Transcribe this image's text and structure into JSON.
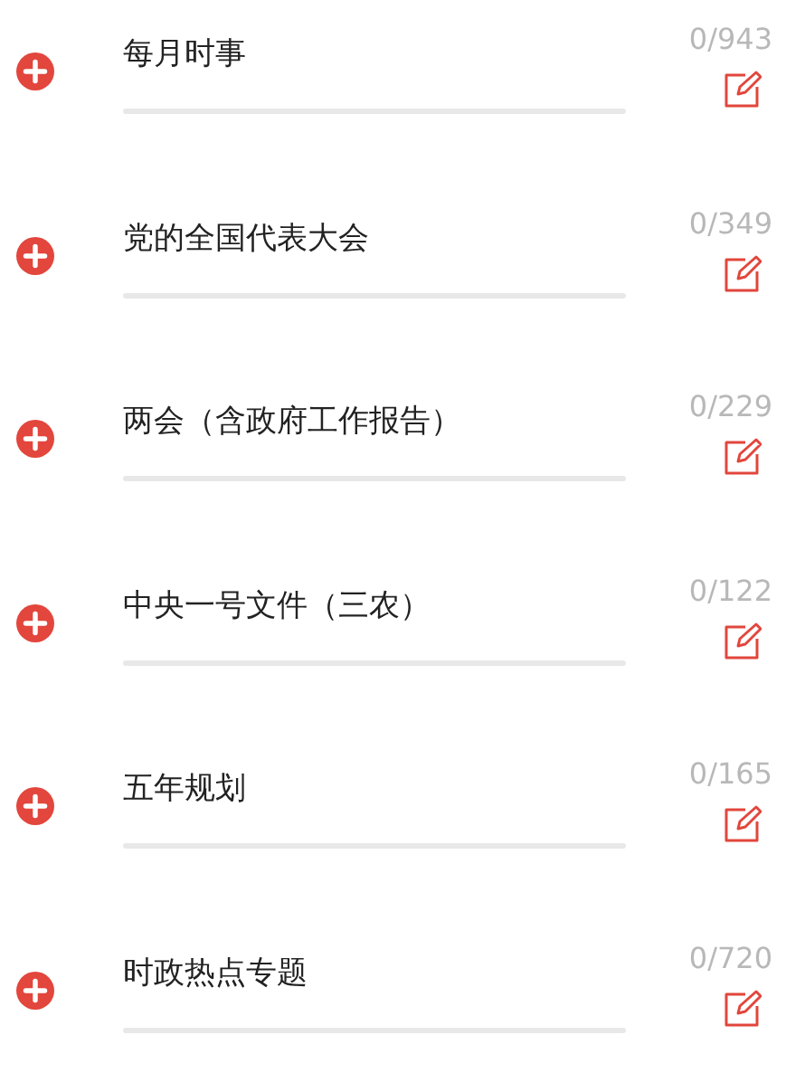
{
  "categories": [
    {
      "title": "每月时事",
      "count": "0/943",
      "level": 0
    },
    {
      "title": "党的全国代表大会",
      "count": "0/349",
      "level": 0
    },
    {
      "title": "两会（含政府工作报告）",
      "count": "0/229",
      "level": 0
    },
    {
      "title": "中央一号文件（三农）",
      "count": "0/122",
      "level": 0
    },
    {
      "title": "五年规划",
      "count": "0/165",
      "level": 0
    },
    {
      "title": "时政热点专题",
      "count": "0/720",
      "level": 0
    }
  ]
}
